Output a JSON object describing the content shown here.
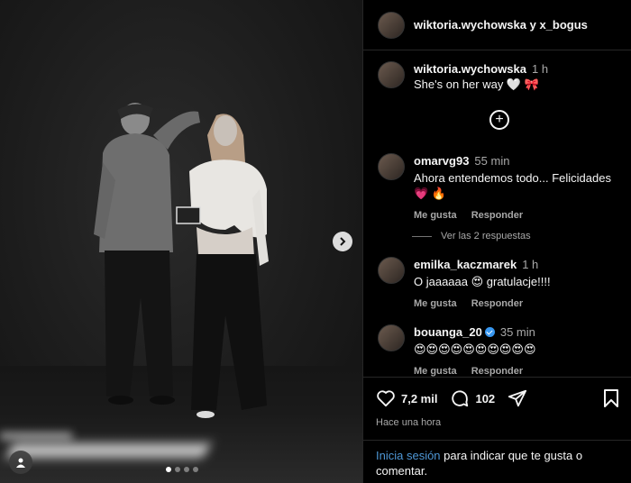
{
  "post": {
    "header_title": "wiktoria.wychowska y x_bogus",
    "caption": {
      "username": "wiktoria.wychowska",
      "time": "1 h",
      "text": "She's on her way 🤍 🎀"
    },
    "carousel": {
      "total": 4,
      "current": 1
    }
  },
  "comments": [
    {
      "username": "omarvg93",
      "time": "55 min",
      "text": "Ahora entendemos todo... Felicidades 💗 🔥",
      "like": "Me gusta",
      "reply": "Responder",
      "verified": false
    },
    {
      "username": "emilka_kaczmarek",
      "time": "1 h",
      "text": "O jaaaaaa 😍 gratulacje!!!!",
      "like": "Me gusta",
      "reply": "Responder",
      "verified": false
    },
    {
      "username": "bouanga_20",
      "time": "35 min",
      "text": "😍😍😍😍😍😍😍😍😍😍",
      "like": "Me gusta",
      "reply": "Responder",
      "verified": true
    }
  ],
  "view_replies": "Ver las 2 respuestas",
  "actions": {
    "likes": "7,2 mil",
    "comments": "102",
    "time_ago": "Hace una hora"
  },
  "login_prompt": {
    "link": "Inicia sesión",
    "text": " para indicar que te gusta o comentar."
  },
  "icons": {
    "like": "heart-icon",
    "comment": "comment-icon",
    "share": "share-icon",
    "save": "bookmark-icon",
    "add": "plus-circle-icon",
    "next": "chevron-right-icon",
    "tag": "user-tag-icon"
  }
}
